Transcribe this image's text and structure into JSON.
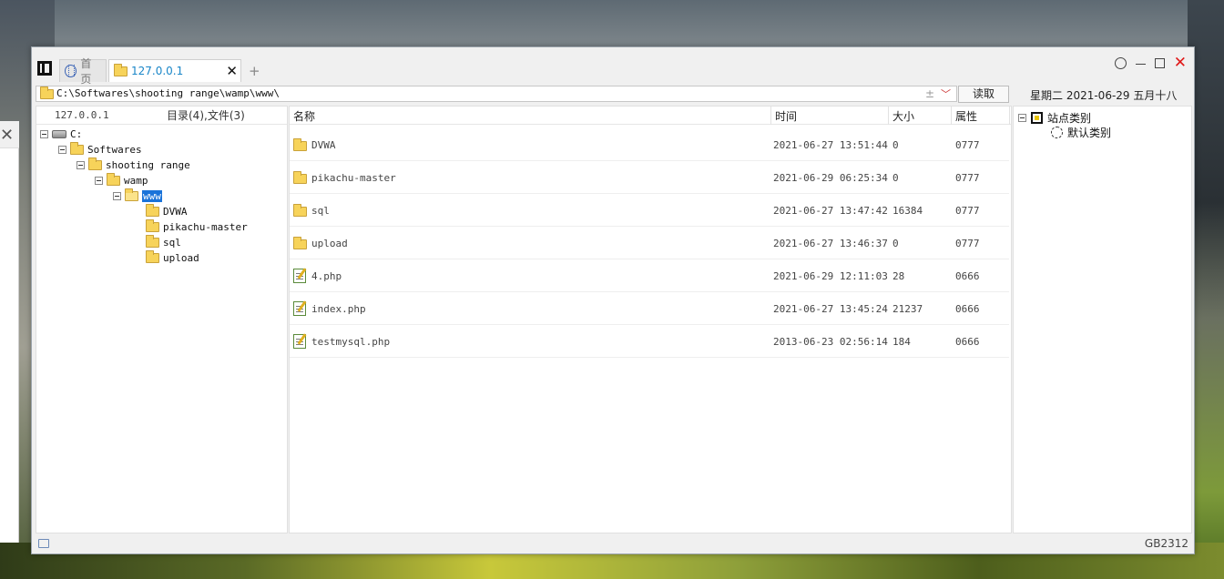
{
  "tabs": {
    "home_label": "首页",
    "active_label": "127.0.0.1",
    "close_glyph": "✕",
    "new_glyph": "+"
  },
  "address": {
    "path": "C:\\Softwares\\shooting range\\wamp\\www\\",
    "history_glyph": "±",
    "dropdown_glyph": "﹀",
    "read_button": "读取"
  },
  "date_line": "星期二  2021-06-29  五月十八",
  "tree": {
    "host": "127.0.0.1",
    "count_label": "目录(4),文件(3)",
    "nodes": {
      "drive": "C:",
      "softwares": "Softwares",
      "shooting_range": "shooting range",
      "wamp": "wamp",
      "www": "www",
      "dvwa": "DVWA",
      "pikachu": "pikachu-master",
      "sql": "sql",
      "upload": "upload"
    }
  },
  "list": {
    "headers": {
      "name": "名称",
      "time": "时间",
      "size": "大小",
      "attr": "属性"
    },
    "rows": [
      {
        "type": "folder",
        "name": "DVWA",
        "time": "2021-06-27 13:51:44",
        "size": "0",
        "attr": "0777"
      },
      {
        "type": "folder",
        "name": "pikachu-master",
        "time": "2021-06-29 06:25:34",
        "size": "0",
        "attr": "0777"
      },
      {
        "type": "folder",
        "name": "sql",
        "time": "2021-06-27 13:47:42",
        "size": "16384",
        "attr": "0777"
      },
      {
        "type": "folder",
        "name": "upload",
        "time": "2021-06-27 13:46:37",
        "size": "0",
        "attr": "0777"
      },
      {
        "type": "php",
        "name": "4.php",
        "time": "2021-06-29 12:11:03",
        "size": "28",
        "attr": "0666"
      },
      {
        "type": "php",
        "name": "index.php",
        "time": "2021-06-27 13:45:24",
        "size": "21237",
        "attr": "0666"
      },
      {
        "type": "php",
        "name": "testmysql.php",
        "time": "2013-06-23 02:56:14",
        "size": "184",
        "attr": "0666"
      }
    ]
  },
  "categories": {
    "root": "站点类别",
    "default": "默认类别"
  },
  "status": {
    "encoding": "GB2312"
  },
  "colors": {
    "accent": "#1a86c8",
    "selection": "#1a73d9",
    "close_red": "#e01818",
    "folder_yellow": "#f7d35a"
  }
}
